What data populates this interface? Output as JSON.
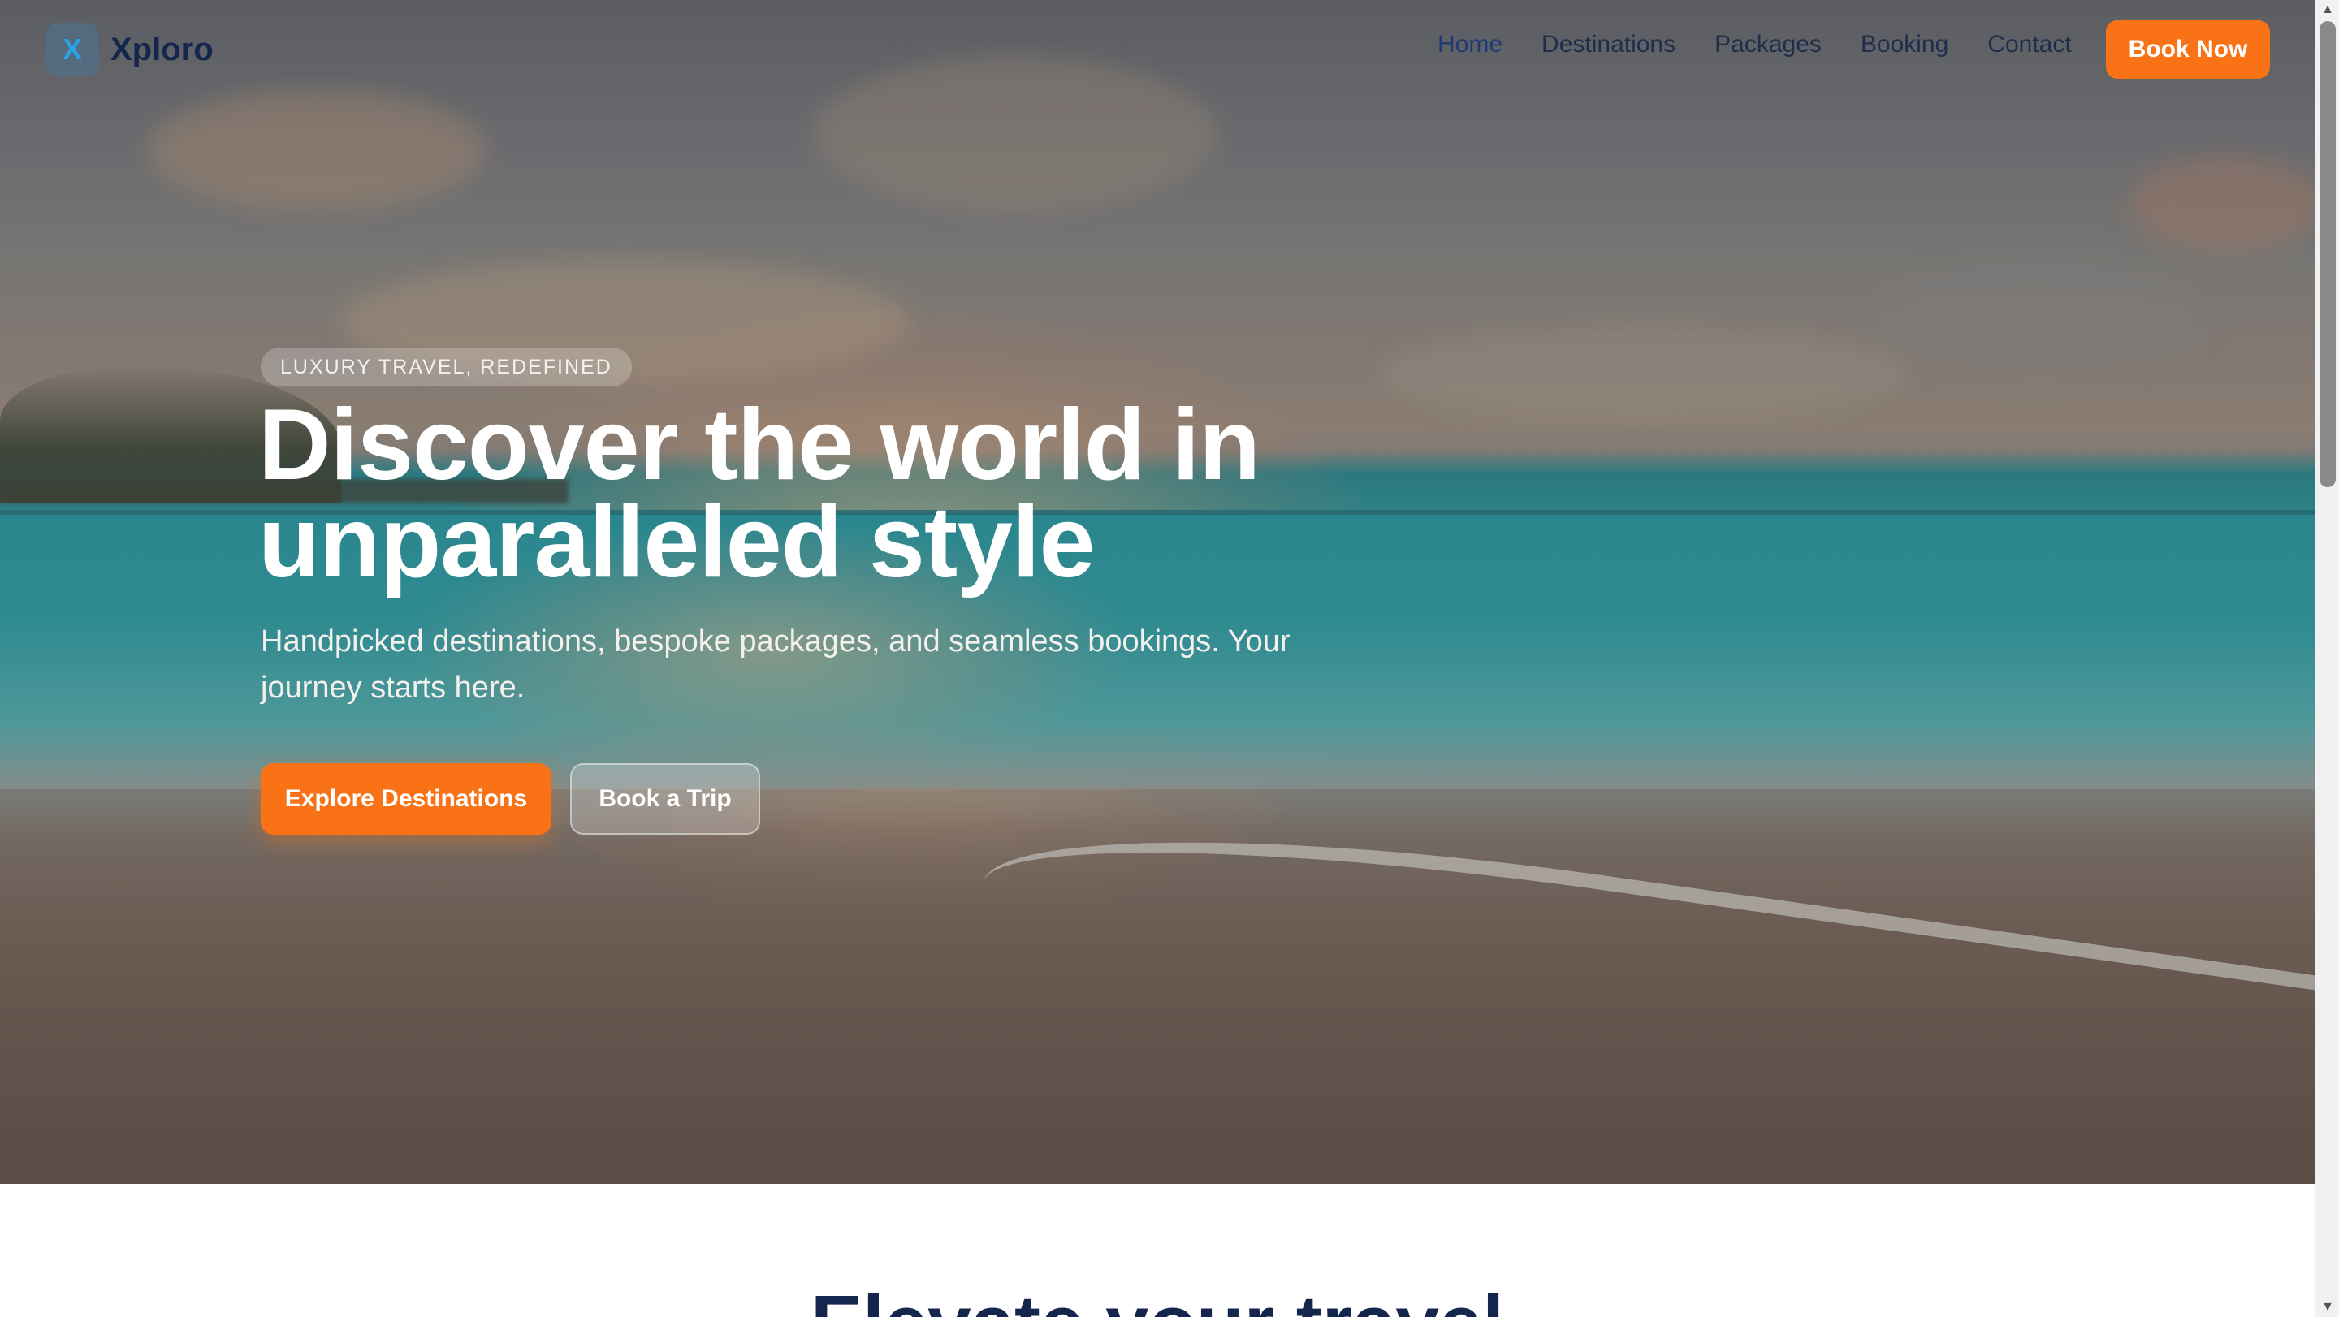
{
  "brand": {
    "logo_letter": "X",
    "name": "Xploro",
    "accent_color": "#f97316",
    "brand_color": "#14264d"
  },
  "nav": {
    "links": [
      {
        "label": "Home",
        "active": true
      },
      {
        "label": "Destinations",
        "active": false
      },
      {
        "label": "Packages",
        "active": false
      },
      {
        "label": "Booking",
        "active": false
      },
      {
        "label": "Contact",
        "active": false
      }
    ],
    "cta_label": "Book Now"
  },
  "hero": {
    "eyebrow": "LUXURY TRAVEL, REDEFINED",
    "headline_line1": "Discover the world in",
    "headline_line2": "unparalleled style",
    "subtext": "Handpicked destinations, bespoke packages, and seamless bookings. Your journey starts here.",
    "primary_cta": "Explore Destinations",
    "secondary_cta": "Book a Trip",
    "background_image": "beach-sunset-photo"
  },
  "next_section": {
    "title": "Elevate your travel"
  },
  "scrollbar": {
    "up_icon": "▲",
    "down_icon": "▼"
  }
}
